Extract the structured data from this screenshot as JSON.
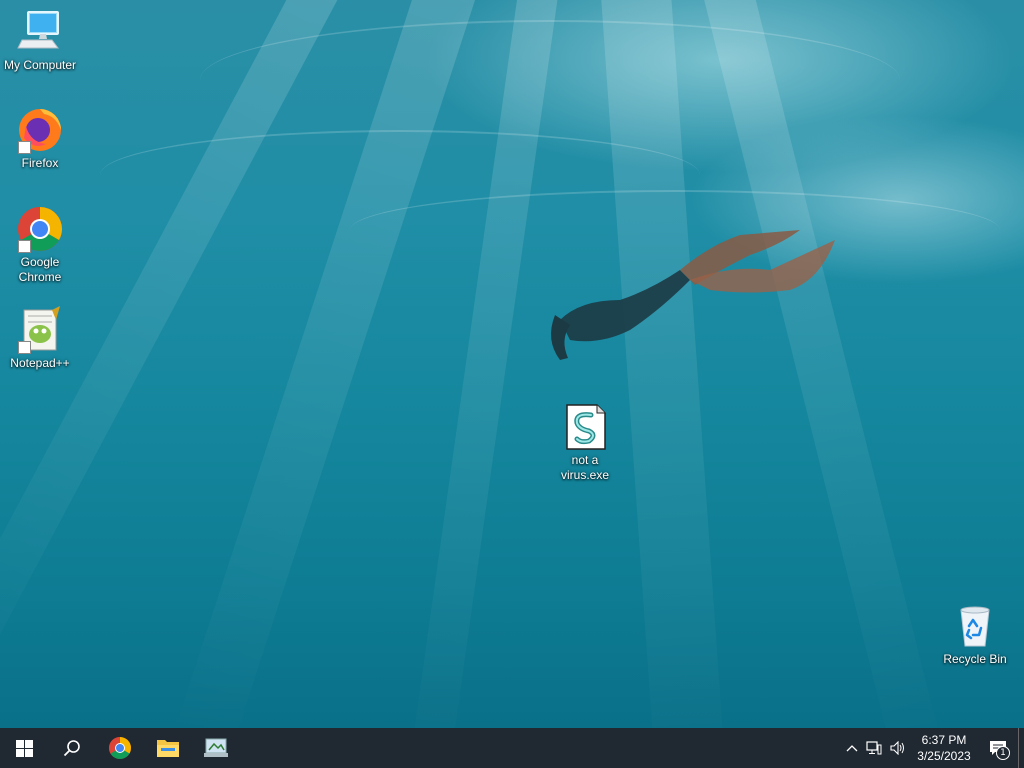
{
  "desktop": {
    "icons": [
      {
        "label": "My Computer"
      },
      {
        "label": "Firefox"
      },
      {
        "label": "Google Chrome"
      },
      {
        "label": "Notepad++"
      },
      {
        "label": "not a virus.exe"
      },
      {
        "label": "Recycle Bin"
      }
    ]
  },
  "taskbar": {
    "items": [
      "start-icon",
      "search-icon",
      "chrome-icon",
      "file-explorer-icon",
      "control-panel-icon"
    ]
  },
  "tray": {
    "time": "6:37 PM",
    "date": "3/25/2023",
    "notification_count": "1"
  },
  "colors": {
    "taskbar": "#202932",
    "accent": "#ffffff"
  }
}
